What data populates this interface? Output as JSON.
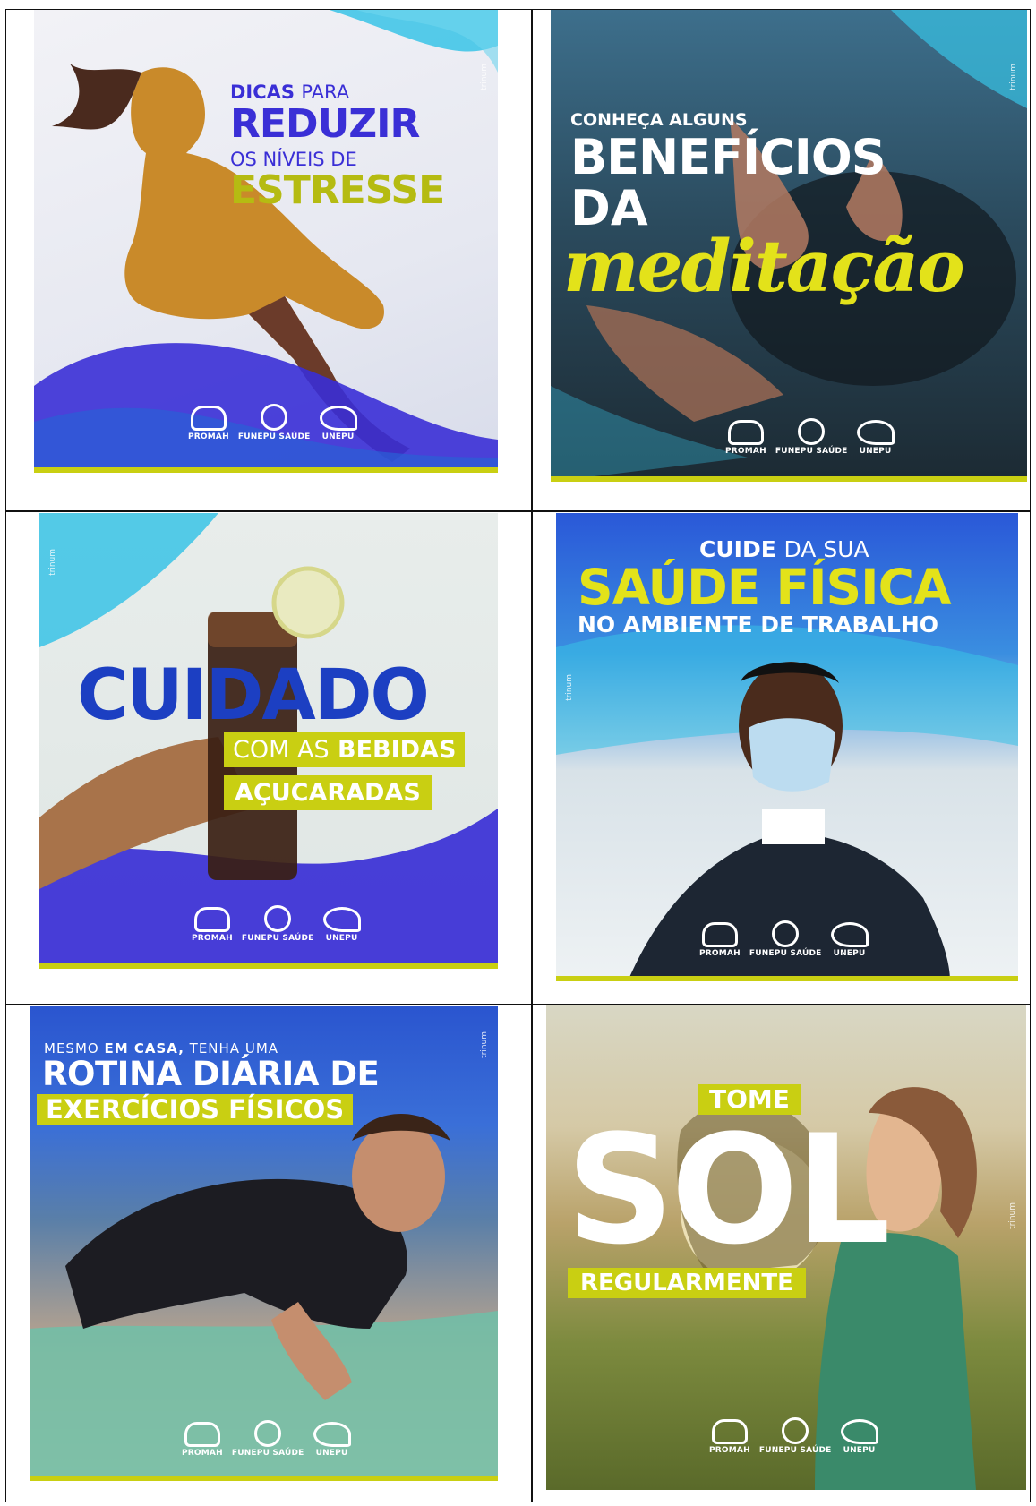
{
  "colors": {
    "accent_yellow": "#c9cf12",
    "accent_blue": "#3a2fd6",
    "deep_blue": "#1c3fc2",
    "cyan": "#38c3e6",
    "white": "#ffffff"
  },
  "logos": {
    "promah": "PROMAH",
    "funepu": "FUNEPU SAÚDE",
    "unepu": "UNEPU"
  },
  "brand_watermark": "trinum",
  "posters": [
    {
      "id": "estresse",
      "line1_bold": "DICAS",
      "line1_rest": "PARA",
      "line2": "REDUZIR",
      "line3": "OS NÍVEIS DE",
      "line4": "ESTRESSE"
    },
    {
      "id": "meditacao",
      "line1": "CONHEÇA ALGUNS",
      "line2": "BENEFÍCIOS",
      "line3": "DA",
      "line4": "meditação"
    },
    {
      "id": "bebidas",
      "line1": "CUIDADO",
      "line2_rest": "COM AS",
      "line2_bold": "BEBIDAS",
      "line3": "AÇUCARADAS"
    },
    {
      "id": "saude-fisica",
      "line1_bold": "CUIDE",
      "line1_rest": "DA SUA",
      "line2": "SAÚDE FÍSICA",
      "line3": "NO AMBIENTE DE TRABALHO"
    },
    {
      "id": "exercicios",
      "line1_rest_a": "MESMO",
      "line1_bold": "EM CASA,",
      "line1_rest_b": "TENHA UMA",
      "line2": "ROTINA DIÁRIA DE",
      "line3": "EXERCÍCIOS FÍSICOS"
    },
    {
      "id": "sol",
      "line1": "TOME",
      "line2": "SOL",
      "line3": "REGULARMENTE"
    }
  ]
}
